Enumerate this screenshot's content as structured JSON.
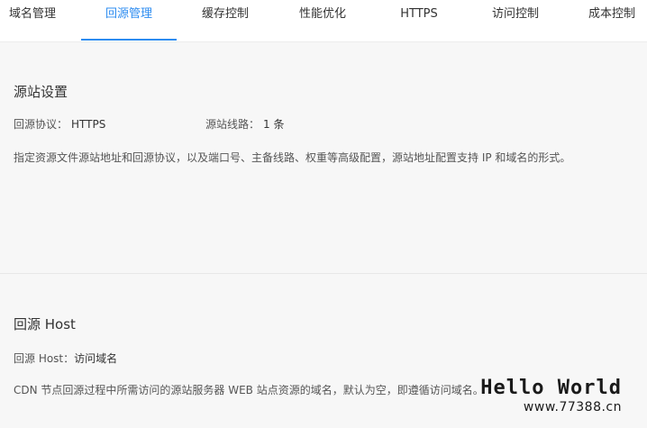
{
  "tabs": [
    {
      "label": "域名管理",
      "active": false
    },
    {
      "label": "回源管理",
      "active": true
    },
    {
      "label": "缓存控制",
      "active": false
    },
    {
      "label": "性能优化",
      "active": false
    },
    {
      "label": "HTTPS",
      "active": false
    },
    {
      "label": "访问控制",
      "active": false
    },
    {
      "label": "成本控制",
      "active": false
    }
  ],
  "colors": {
    "accent": "#2d8cf0",
    "content_bg": "#f7f7f7"
  },
  "origin_settings": {
    "title": "源站设置",
    "protocol_label": "回源协议：",
    "protocol_value": "HTTPS",
    "lines_label": "源站线路：",
    "lines_value": "1 条",
    "description": "指定资源文件源站地址和回源协议，以及端口号、主备线路、权重等高级配置，源站地址配置支持 IP 和域名的形式。"
  },
  "origin_host": {
    "title": "回源 Host",
    "host_label": "回源 Host：",
    "host_value": "访问域名",
    "description": "CDN 节点回源过程中所需访问的源站服务器 WEB 站点资源的域名，默认为空，即遵循访问域名。"
  },
  "watermark": {
    "title": "Hello World",
    "url": "www.77388.cn"
  }
}
